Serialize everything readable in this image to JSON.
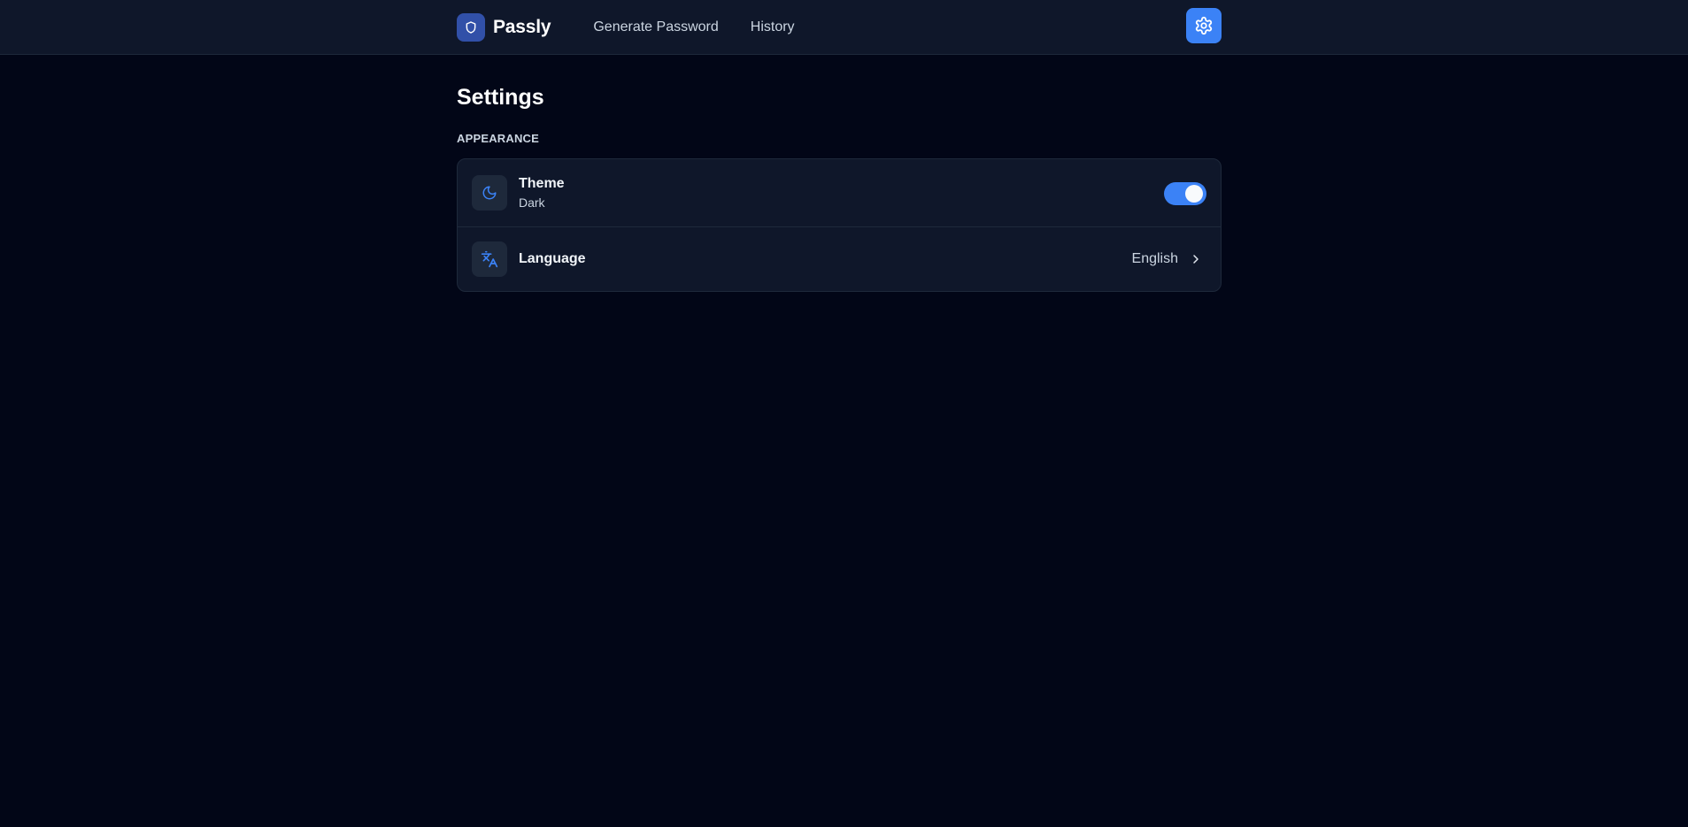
{
  "app": {
    "name": "Passly"
  },
  "nav": {
    "items": [
      {
        "label": "Generate Password"
      },
      {
        "label": "History"
      }
    ]
  },
  "header": {
    "settings_icon": "gear-icon"
  },
  "page": {
    "title": "Settings"
  },
  "sections": [
    {
      "label": "APPEARANCE",
      "rows": [
        {
          "title": "Theme",
          "subtitle": "Dark",
          "icon": "moon-icon",
          "toggle_on": true
        },
        {
          "title": "Language",
          "value": "English",
          "icon": "translate-icon",
          "trailing_icon": "chevron-right-icon"
        }
      ]
    }
  ],
  "colors": {
    "accent": "#3b82f6",
    "background": "#020617",
    "surface": "#0f172a",
    "border": "#1e293b"
  }
}
